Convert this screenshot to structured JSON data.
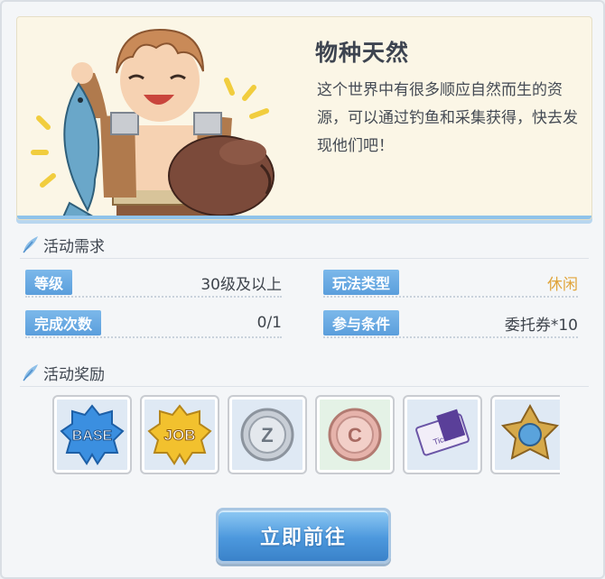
{
  "event": {
    "title": "物种天然",
    "description": "这个世界中有很多顺应自然而生的资源，可以通过钓鱼和采集获得，快去发现他们吧！"
  },
  "requirements": {
    "section_label": "活动需求",
    "level_label": "等级",
    "level_value": "30级及以上",
    "type_label": "玩法类型",
    "type_value": "休闲",
    "completions_label": "完成次数",
    "completions_value": "0/1",
    "condition_label": "参与条件",
    "condition_value": "委托券*10"
  },
  "rewards": {
    "section_label": "活动奖励",
    "base_text": "BASE",
    "job_text": "JOB",
    "zeny_text": "Z",
    "coin_text": "C",
    "ticket_text": "Ticket",
    "items": [
      "base-exp-icon",
      "job-exp-icon",
      "zeny-coin-icon",
      "copper-coin-icon",
      "ticket-icon",
      "emblem-icon"
    ]
  },
  "actions": {
    "go_label": "立即前往"
  },
  "colors": {
    "accent_blue": "#5a9edc",
    "casual_orange": "#e0a43a"
  }
}
